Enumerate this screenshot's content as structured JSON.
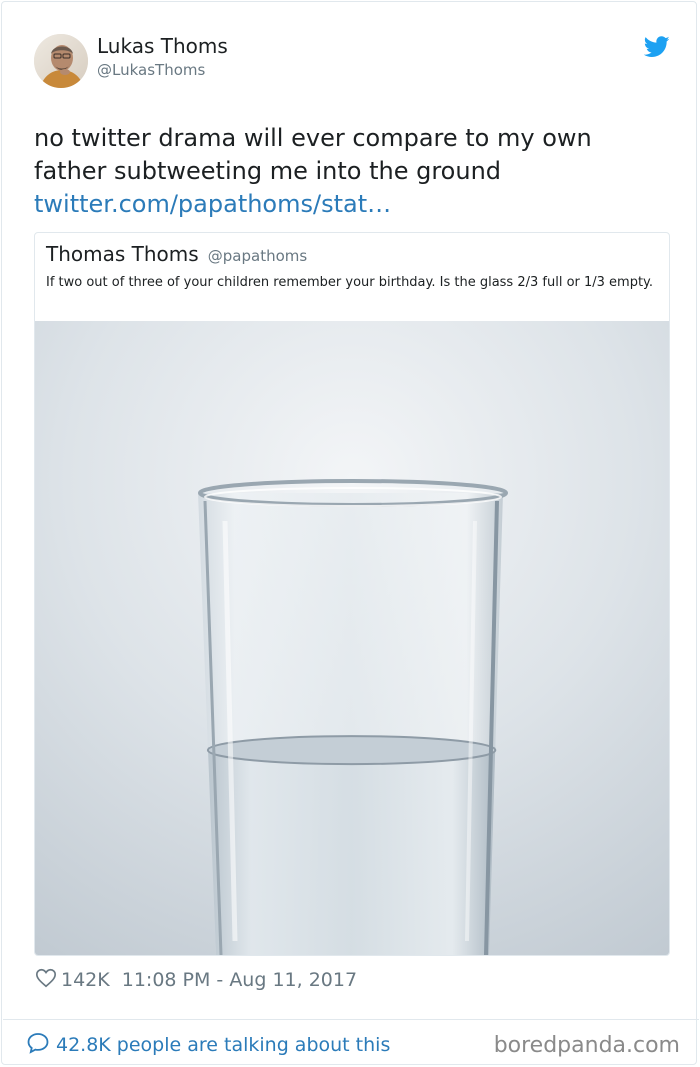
{
  "tweet": {
    "author_name": "Lukas Thoms",
    "author_handle": "@LukasThoms",
    "text_line1": "no twitter drama will ever compare to my own",
    "text_line2": "father subtweeting me into the ground",
    "link_text": "twitter.com/papathoms/stat…",
    "likes": "142K",
    "timestamp": "11:08 PM - Aug 11, 2017",
    "talking": "42.8K people are talking about this",
    "icons": [
      "avatar",
      "twitter-bird-icon",
      "heart-icon",
      "chat-bubble-icon"
    ],
    "colors": {
      "link": "#2b7bb9",
      "bird": "#1da1f2",
      "muted": "#697882"
    }
  },
  "quoted": {
    "author_name": "Thomas Thoms",
    "author_handle": "@papathoms",
    "text": "If two out of three of your children remember your birthday. Is the glass 2/3 full or 1/3 empty.",
    "image": {
      "subject": "glass-of-water",
      "fill_fraction": 0.45
    }
  },
  "watermark": "boredpanda.com"
}
